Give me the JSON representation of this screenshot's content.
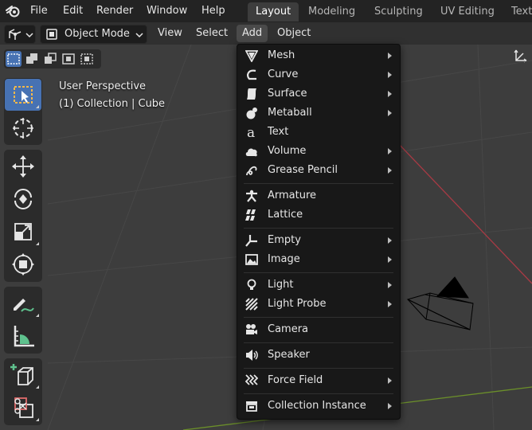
{
  "topbar": {
    "menus": [
      "File",
      "Edit",
      "Render",
      "Window",
      "Help"
    ],
    "workspaces": [
      "Layout",
      "Modeling",
      "Sculpting",
      "UV Editing",
      "Text"
    ]
  },
  "header": {
    "mode_label": "Object Mode",
    "menus": [
      "View",
      "Select",
      "Add",
      "Object"
    ]
  },
  "viewport": {
    "perspective_label": "User Perspective",
    "collection_label": "(1) Collection | Cube"
  },
  "add_menu": {
    "items": [
      {
        "label": "Mesh",
        "icon": "mesh-icon",
        "submenu": true
      },
      {
        "label": "Curve",
        "icon": "curve-icon",
        "submenu": true
      },
      {
        "label": "Surface",
        "icon": "surface-icon",
        "submenu": true
      },
      {
        "label": "Metaball",
        "icon": "metaball-icon",
        "submenu": true
      },
      {
        "label": "Text",
        "icon": "text-icon",
        "submenu": false
      },
      {
        "label": "Volume",
        "icon": "volume-icon",
        "submenu": true
      },
      {
        "label": "Grease Pencil",
        "icon": "grease-pencil-icon",
        "submenu": true
      },
      {
        "label": "Armature",
        "icon": "armature-icon",
        "submenu": false
      },
      {
        "label": "Lattice",
        "icon": "lattice-icon",
        "submenu": false
      },
      {
        "label": "Empty",
        "icon": "empty-icon",
        "submenu": true
      },
      {
        "label": "Image",
        "icon": "image-icon",
        "submenu": true
      },
      {
        "label": "Light",
        "icon": "light-icon",
        "submenu": true
      },
      {
        "label": "Light Probe",
        "icon": "light-probe-icon",
        "submenu": true
      },
      {
        "label": "Camera",
        "icon": "camera-icon",
        "submenu": false
      },
      {
        "label": "Speaker",
        "icon": "speaker-icon",
        "submenu": false
      },
      {
        "label": "Force Field",
        "icon": "force-field-icon",
        "submenu": true
      },
      {
        "label": "Collection Instance",
        "icon": "collection-instance-icon",
        "submenu": true
      }
    ]
  },
  "toolbar": {
    "tools": [
      "select-box-icon",
      "cursor-icon",
      "move-icon",
      "rotate-icon",
      "scale-icon",
      "transform-icon",
      "annotate-icon",
      "measure-icon",
      "add-cube-icon",
      "extrude-icon"
    ]
  },
  "colors": {
    "accent": "#4772b3",
    "menu_bg": "#181818",
    "viewport_bg": "#3d3d3d",
    "x_axis": "#a83a44",
    "y_axis": "#6b8f2a"
  }
}
